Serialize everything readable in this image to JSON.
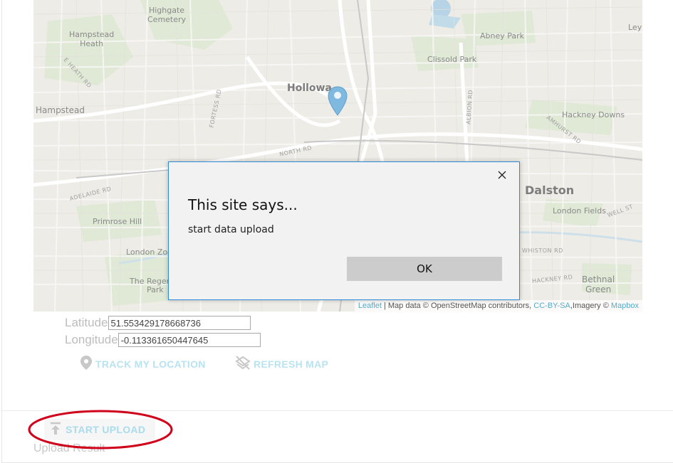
{
  "map": {
    "labels": {
      "highgate_cemetery": "Highgate\nCemetery",
      "hampstead_heath": "Hampstead\nHeath",
      "hampstead": "Hampstead",
      "abney_park": "Abney Park",
      "clissold_park": "Clissold Park",
      "holloway": "Hollowa",
      "hackney_downs": "Hackney Downs",
      "dalston": "Dalston",
      "london_fields": "London Fields",
      "primrose_hill": "Primrose Hill",
      "london_zoo": "London Zoo",
      "regents_park": "The Regent's\nPark",
      "bethnal_green": "Bethnal\nGreen",
      "ley": "Ley",
      "road_fortess": "FORTESS RD",
      "road_north": "NORTH RD",
      "road_albion": "ALBION RD",
      "road_amhurst": "AMHURST RD",
      "road_adelaide": "ADELAIDE RD",
      "road_eheath": "E HEATH RD",
      "road_whiston": "WHISTON RD",
      "road_hackney": "HACKNEY RD",
      "road_wellst": "WELL ST"
    },
    "attribution": {
      "leaflet": "Leaflet",
      "map_data": " | Map data © OpenStreetMap contributors, ",
      "license": "CC-BY-SA",
      "imagery": ",Imagery © ",
      "mapbox": "Mapbox"
    }
  },
  "coords": {
    "latitude_label": "Latitude",
    "latitude_value": "51.553429178668736",
    "longitude_label": "Longitude",
    "longitude_value": "-0.113361650447645"
  },
  "actions": {
    "track_label": "TRACK MY LOCATION",
    "refresh_label": "REFRESH MAP",
    "upload_label": "START UPLOAD",
    "upload_result_label": "Upload Result"
  },
  "dialog": {
    "title": "This site says...",
    "message": "start data upload",
    "ok_label": "OK"
  },
  "colors": {
    "accent": "#b9e3f0",
    "dialog_border": "#2f8bd8",
    "highlight": "#d0021b",
    "marker": "#7fb9e0"
  },
  "icons": {
    "marker": "map-marker-icon",
    "track": "location-pin-icon",
    "refresh": "layers-off-icon",
    "upload": "upload-icon",
    "close": "close-icon"
  }
}
